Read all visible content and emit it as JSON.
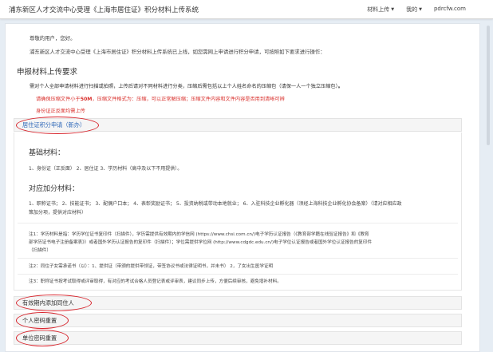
{
  "navbar": {
    "title": "浦东新区人才交流中心受理《上海市居住证》积分材料上传系统",
    "menu_upload": "材料上传",
    "menu_mine": "我的",
    "site": "pdrcfw.com"
  },
  "main": {
    "greeting": "尊敬的用户，您好。",
    "intro": "浦东新区人才交流中心受理《上海市居住证》积分材料上传系统已上线，如您需网上申请进行积分申请，可按照如下要求进行操作：",
    "requirements_title": "申报材料上传要求",
    "req_line1_prefix": "需对个人全部申请材料进行扫描或拍照，上传后请对不同材料进行分类，压缩后需包括以上个人姓名命名的压缩包（请保一人一个独立压缩包）",
    "req_line1_bold": "。",
    "req_red1_prefix": "请确保压缩文件小于",
    "req_red1_bold": "50M",
    "req_red1_suffix": "，压缩文件格式为：压缩，可以正常解压缩；压缩文件内容和文件内容是否用到清晰可辨",
    "req_red2": "身份证正反面均需上传"
  },
  "accordions": {
    "residence_apply": "居住证积分申请（新办）",
    "add_cohabitant": "有效期内添加同住人",
    "reset_personal_pwd": "个人密码重置",
    "reset_unit_pwd": "单位密码重置"
  },
  "section_open": {
    "basic_title": "基础材料：",
    "basic_text": "1、身份证（正反面）  2、居住证  3、学历材料（高中及以下不用提供）。",
    "extra_title": "对应加分材料：",
    "extra_text_1": "1、职称证书；  2、技能证书；  3、配偶户口本；  4、表彰奖励证书；  5、投资纳税或带动本地就业；  6、入驻科技企业孵化器（须经上海科技企业孵化协会备案）（请对应相应政",
    "extra_text_2": "策加分项，提供对应材料）",
    "note1_a": "注1：学历材料是指：学历学位证书复印件（扫描件），学历需提供有效期内的学信网 (https://www.chsi.com.cn/)电子学历认证报告（《教育部学籍在线验证报告》和《教育",
    "note1_b": "部学历证书电子注册备案表》）或者国外学历认证报告的复印件（扫描件）；学位需提供学位网 (http://www.cdgdc.edu.cn/)电子学位认证报告或者国外学位认证报告的复印件",
    "note1_c": "（扫描件）",
    "note2": "注2：同住子女需承诺书（以）：1、提供证（带颁的提供带领证，带签协议书或法律证明书，并未书）  2，了女出生医学证明",
    "note3": "注3：职称证书按考试取得或评审取得，有对应的考试合格人员登记表或评审表，建议同步上传，方便后续审核，避免增补材料。"
  }
}
